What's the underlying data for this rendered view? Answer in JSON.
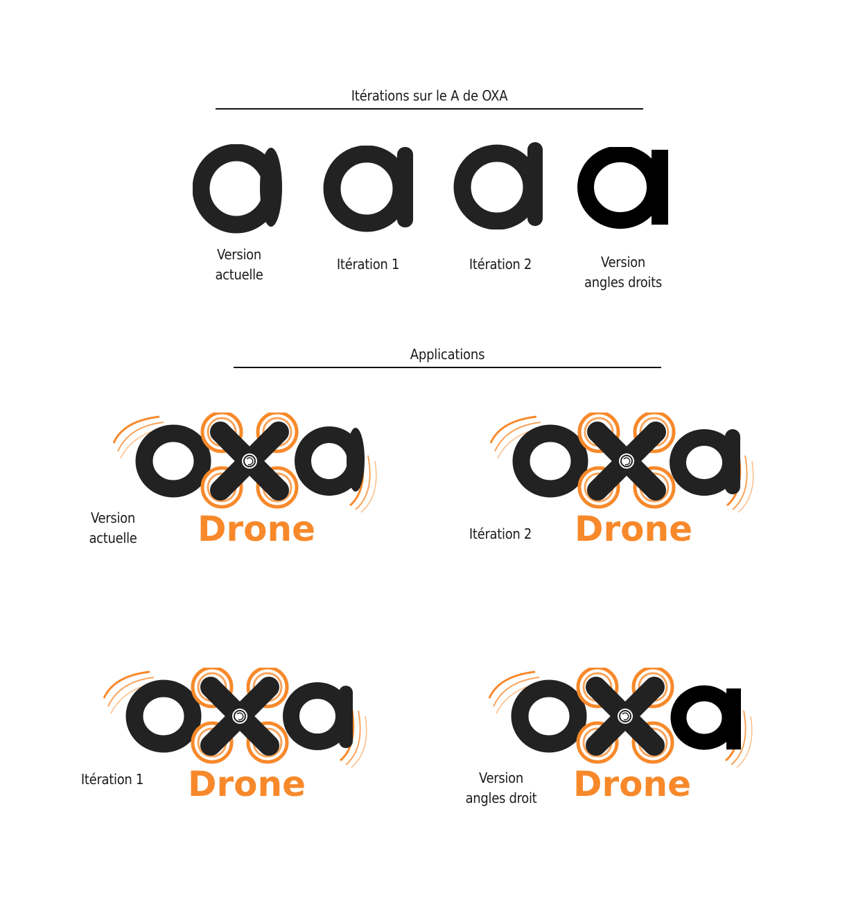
{
  "sections": {
    "iterations_title": "Itérations sur le A de OXA",
    "applications_title": "Applications"
  },
  "glyphs": [
    {
      "caption_line1": "Version",
      "caption_line2": "actuelle"
    },
    {
      "caption_line1": "Itération 1",
      "caption_line2": ""
    },
    {
      "caption_line1": "Itération 2",
      "caption_line2": ""
    },
    {
      "caption_line1": "Version",
      "caption_line2": "angles droits"
    }
  ],
  "applications": [
    {
      "caption_line1": "Version",
      "caption_line2": "actuelle",
      "wordmark": "oxa",
      "sub": "Drone"
    },
    {
      "caption_line1": "Itération 2",
      "caption_line2": "",
      "wordmark": "oxa",
      "sub": "Drone"
    },
    {
      "caption_line1": "Itération 1",
      "caption_line2": "",
      "wordmark": "oxa",
      "sub": "Drone"
    },
    {
      "caption_line1": "Version",
      "caption_line2": "angles droit",
      "wordmark": "oxa",
      "sub": "Drone"
    }
  ],
  "colors": {
    "ink": "#222222",
    "black": "#000000",
    "orange": "#f7892b",
    "orange_light": "#f9a35b"
  }
}
